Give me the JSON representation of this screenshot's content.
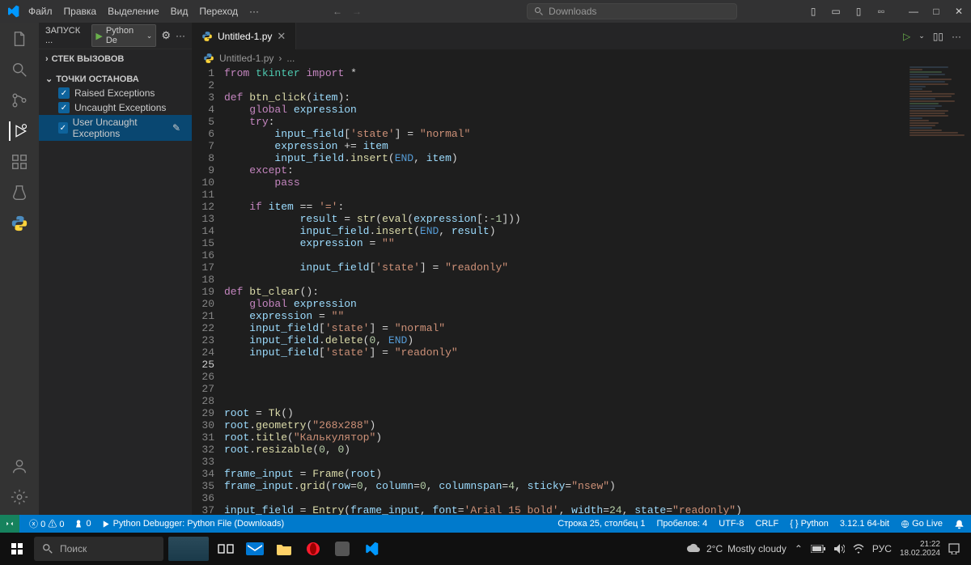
{
  "menubar": {
    "items": [
      "Файл",
      "Правка",
      "Выделение",
      "Вид",
      "Переход",
      "···"
    ],
    "search_placeholder": "Downloads"
  },
  "sidebar": {
    "run_label": "ЗАПУСК ...",
    "config_label": "Python De",
    "call_stack": "СТЕК ВЫЗОВОВ",
    "breakpoints": "ТОЧКИ ОСТАНОВА",
    "checks": [
      {
        "label": "Raised Exceptions",
        "checked": true
      },
      {
        "label": "Uncaught Exceptions",
        "checked": true
      },
      {
        "label": "User Uncaught Exceptions",
        "checked": true,
        "selected": true
      }
    ]
  },
  "tab": {
    "name": "Untitled-1.py"
  },
  "breadcrumb": {
    "file": "Untitled-1.py",
    "more": "..."
  },
  "code": {
    "current_line": 25,
    "lines": [
      [
        [
          "kw",
          "from"
        ],
        [
          " "
        ],
        [
          "mod",
          "tkinter"
        ],
        [
          " "
        ],
        [
          "kw",
          "import"
        ],
        [
          " "
        ],
        [
          "op",
          "*"
        ]
      ],
      [],
      [
        [
          "kw",
          "def"
        ],
        [
          " "
        ],
        [
          "fn",
          "btn_click"
        ],
        [
          "op",
          "("
        ],
        [
          "var",
          "item"
        ],
        [
          "op",
          "):"
        ]
      ],
      [
        [
          "",
          "    "
        ],
        [
          "kw",
          "global"
        ],
        [
          " "
        ],
        [
          "var",
          "expression"
        ]
      ],
      [
        [
          "",
          "    "
        ],
        [
          "kw",
          "try"
        ],
        [
          "op",
          ":"
        ]
      ],
      [
        [
          "",
          "        "
        ],
        [
          "var",
          "input_field"
        ],
        [
          "op",
          "["
        ],
        [
          "str",
          "'state'"
        ],
        [
          "op",
          "] = "
        ],
        [
          "str",
          "\"normal\""
        ]
      ],
      [
        [
          "",
          "        "
        ],
        [
          "var",
          "expression"
        ],
        [
          " += "
        ],
        [
          "var",
          "item"
        ]
      ],
      [
        [
          "",
          "        "
        ],
        [
          "var",
          "input_field"
        ],
        [
          "op",
          "."
        ],
        [
          "fn",
          "insert"
        ],
        [
          "op",
          "("
        ],
        [
          "const",
          "END"
        ],
        [
          "op",
          ", "
        ],
        [
          "var",
          "item"
        ],
        [
          "op",
          ")"
        ]
      ],
      [
        [
          "",
          "    "
        ],
        [
          "kw",
          "except"
        ],
        [
          "op",
          ":"
        ]
      ],
      [
        [
          "",
          "        "
        ],
        [
          "kw",
          "pass"
        ]
      ],
      [],
      [
        [
          "",
          "    "
        ],
        [
          "kw",
          "if"
        ],
        [
          " "
        ],
        [
          "var",
          "item"
        ],
        [
          " == "
        ],
        [
          "str",
          "'='"
        ],
        [
          "op",
          ":"
        ]
      ],
      [
        [
          "",
          "            "
        ],
        [
          "var",
          "result"
        ],
        [
          " = "
        ],
        [
          "fn",
          "str"
        ],
        [
          "op",
          "("
        ],
        [
          "fn",
          "eval"
        ],
        [
          "op",
          "("
        ],
        [
          "var",
          "expression"
        ],
        [
          "op",
          "[:"
        ],
        [
          "num",
          "-1"
        ],
        [
          "op",
          "]))"
        ]
      ],
      [
        [
          "",
          "            "
        ],
        [
          "var",
          "input_field"
        ],
        [
          "op",
          "."
        ],
        [
          "fn",
          "insert"
        ],
        [
          "op",
          "("
        ],
        [
          "const",
          "END"
        ],
        [
          "op",
          ", "
        ],
        [
          "var",
          "result"
        ],
        [
          "op",
          ")"
        ]
      ],
      [
        [
          "",
          "            "
        ],
        [
          "var",
          "expression"
        ],
        [
          " = "
        ],
        [
          "str",
          "\"\""
        ]
      ],
      [],
      [
        [
          "",
          "            "
        ],
        [
          "var",
          "input_field"
        ],
        [
          "op",
          "["
        ],
        [
          "str",
          "'state'"
        ],
        [
          "op",
          "] = "
        ],
        [
          "str",
          "\"readonly\""
        ]
      ],
      [],
      [
        [
          "kw",
          "def"
        ],
        [
          " "
        ],
        [
          "fn",
          "bt_clear"
        ],
        [
          "op",
          "():"
        ]
      ],
      [
        [
          "",
          "    "
        ],
        [
          "kw",
          "global"
        ],
        [
          " "
        ],
        [
          "var",
          "expression"
        ]
      ],
      [
        [
          "",
          "    "
        ],
        [
          "var",
          "expression"
        ],
        [
          " = "
        ],
        [
          "str",
          "\"\""
        ]
      ],
      [
        [
          "",
          "    "
        ],
        [
          "var",
          "input_field"
        ],
        [
          "op",
          "["
        ],
        [
          "str",
          "'state'"
        ],
        [
          "op",
          "] = "
        ],
        [
          "str",
          "\"normal\""
        ]
      ],
      [
        [
          "",
          "    "
        ],
        [
          "var",
          "input_field"
        ],
        [
          "op",
          "."
        ],
        [
          "fn",
          "delete"
        ],
        [
          "op",
          "("
        ],
        [
          "num",
          "0"
        ],
        [
          "op",
          ", "
        ],
        [
          "const",
          "END"
        ],
        [
          "op",
          ")"
        ]
      ],
      [
        [
          "",
          "    "
        ],
        [
          "var",
          "input_field"
        ],
        [
          "op",
          "["
        ],
        [
          "str",
          "'state'"
        ],
        [
          "op",
          "] = "
        ],
        [
          "str",
          "\"readonly\""
        ]
      ],
      [],
      [],
      [],
      [],
      [
        [
          "var",
          "root"
        ],
        [
          " = "
        ],
        [
          "fn",
          "Tk"
        ],
        [
          "op",
          "()"
        ]
      ],
      [
        [
          "var",
          "root"
        ],
        [
          "op",
          "."
        ],
        [
          "fn",
          "geometry"
        ],
        [
          "op",
          "("
        ],
        [
          "str",
          "\"268x288\""
        ],
        [
          "op",
          ")"
        ]
      ],
      [
        [
          "var",
          "root"
        ],
        [
          "op",
          "."
        ],
        [
          "fn",
          "title"
        ],
        [
          "op",
          "("
        ],
        [
          "str",
          "\"Калькулятор\""
        ],
        [
          "op",
          ")"
        ]
      ],
      [
        [
          "var",
          "root"
        ],
        [
          "op",
          "."
        ],
        [
          "fn",
          "resizable"
        ],
        [
          "op",
          "("
        ],
        [
          "num",
          "0"
        ],
        [
          "op",
          ", "
        ],
        [
          "num",
          "0"
        ],
        [
          "op",
          ")"
        ]
      ],
      [],
      [
        [
          "var",
          "frame_input"
        ],
        [
          " = "
        ],
        [
          "fn",
          "Frame"
        ],
        [
          "op",
          "("
        ],
        [
          "var",
          "root"
        ],
        [
          "op",
          ")"
        ]
      ],
      [
        [
          "var",
          "frame_input"
        ],
        [
          "op",
          "."
        ],
        [
          "fn",
          "grid"
        ],
        [
          "op",
          "("
        ],
        [
          "var",
          "row"
        ],
        [
          "op",
          "="
        ],
        [
          "num",
          "0"
        ],
        [
          "op",
          ", "
        ],
        [
          "var",
          "column"
        ],
        [
          "op",
          "="
        ],
        [
          "num",
          "0"
        ],
        [
          "op",
          ", "
        ],
        [
          "var",
          "columnspan"
        ],
        [
          "op",
          "="
        ],
        [
          "num",
          "4"
        ],
        [
          "op",
          ", "
        ],
        [
          "var",
          "sticky"
        ],
        [
          "op",
          "="
        ],
        [
          "str",
          "\"nsew\""
        ],
        [
          "op",
          ")"
        ]
      ],
      [],
      [
        [
          "var",
          "input_field"
        ],
        [
          " = "
        ],
        [
          "fn",
          "Entry"
        ],
        [
          "op",
          "("
        ],
        [
          "var",
          "frame_input"
        ],
        [
          "op",
          ", "
        ],
        [
          "var",
          "font"
        ],
        [
          "op",
          "="
        ],
        [
          "str",
          "'Arial 15 bold'"
        ],
        [
          "op",
          ", "
        ],
        [
          "var",
          "width"
        ],
        [
          "op",
          "="
        ],
        [
          "num",
          "24"
        ],
        [
          "op",
          ", "
        ],
        [
          "var",
          "state"
        ],
        [
          "op",
          "="
        ],
        [
          "str",
          "\"readonly\""
        ],
        [
          "op",
          ")"
        ]
      ]
    ]
  },
  "statusbar": {
    "errors": "0",
    "warnings": "0",
    "radio": "0",
    "debugger": "Python Debugger: Python File (Downloads)",
    "cursor": "Строка 25, столбец 1",
    "spaces": "Пробелов: 4",
    "encoding": "UTF-8",
    "eol": "CRLF",
    "lang": "Python",
    "interpreter": "3.12.1 64-bit",
    "go_live": "Go Live"
  },
  "taskbar": {
    "search": "Поиск",
    "weather_temp": "2°C",
    "weather_desc": "Mostly cloudy",
    "lang": "РУС",
    "time": "21:22",
    "date": "18.02.2024"
  }
}
